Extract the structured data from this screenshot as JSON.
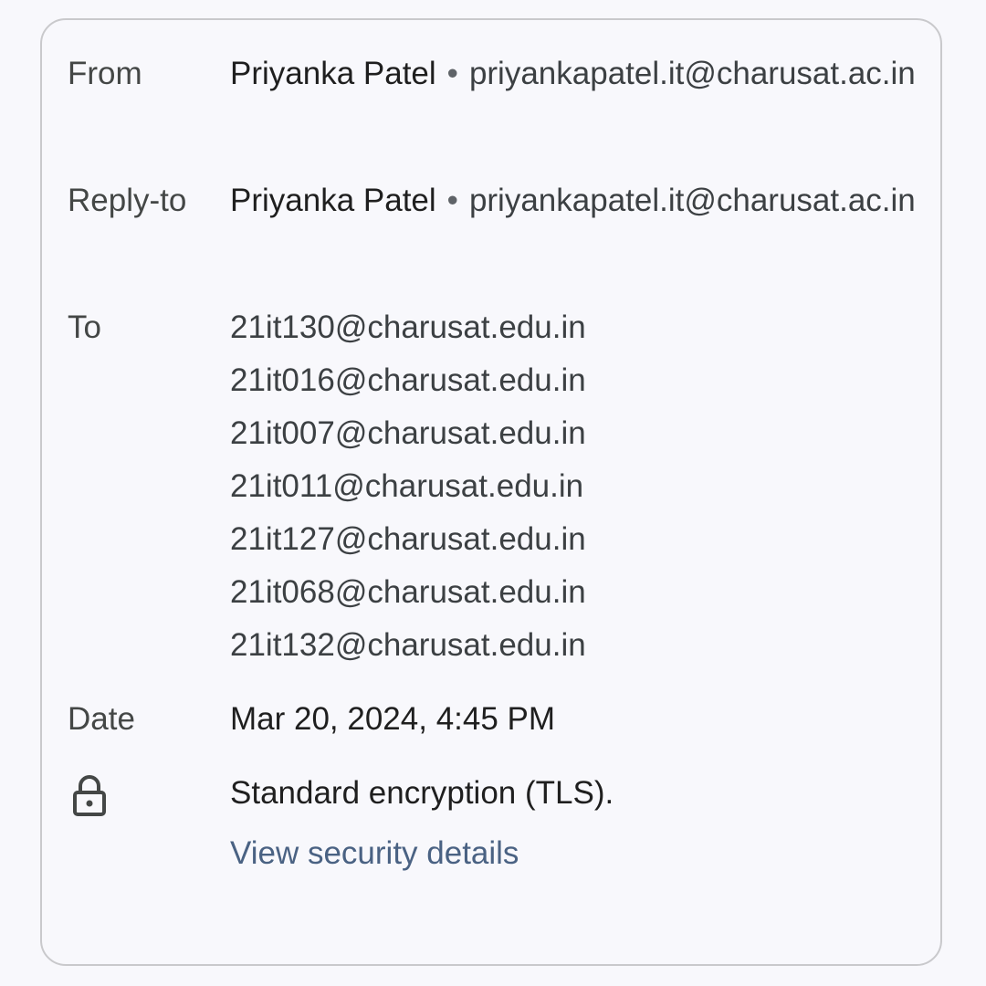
{
  "from": {
    "label": "From",
    "name": "Priyanka Patel",
    "separator": "•",
    "email": "priyankapatel.it@charusat.ac.in"
  },
  "reply_to": {
    "label": "Reply-to",
    "name": "Priyanka Patel",
    "separator": "•",
    "email": "priyankapatel.it@charusat.ac.in"
  },
  "to": {
    "label": "To",
    "recipients": [
      "21it130@charusat.edu.in",
      "21it016@charusat.edu.in",
      "21it007@charusat.edu.in",
      "21it011@charusat.edu.in",
      "21it127@charusat.edu.in",
      "21it068@charusat.edu.in",
      "21it132@charusat.edu.in"
    ]
  },
  "date": {
    "label": "Date",
    "value": "Mar 20, 2024, 4:45 PM"
  },
  "security": {
    "icon": "lock-icon",
    "text": "Standard encryption (TLS).",
    "link_label": "View security details",
    "link_color": "#4a6283"
  }
}
